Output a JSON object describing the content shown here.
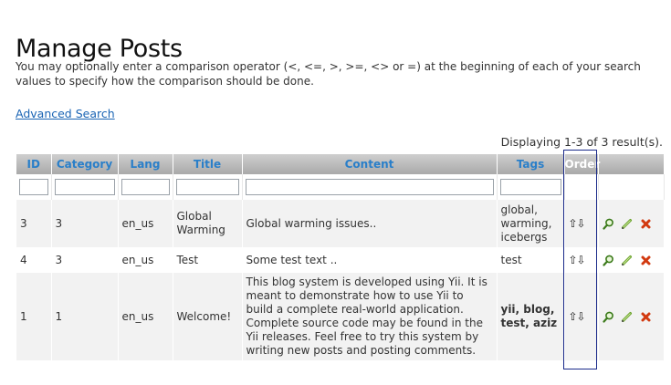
{
  "page": {
    "title": "Manage Posts",
    "intro": "You may optionally enter a comparison operator (<, <=, >, >=, <> or =) at the beginning of each of your search values to specify how the comparison should be done.",
    "advanced_search": "Advanced Search",
    "summary": "Displaying 1-3 of 3 result(s)."
  },
  "grid": {
    "columns": [
      "ID",
      "Category",
      "Lang",
      "Title",
      "Content",
      "Tags",
      "Order"
    ],
    "filters": [
      "",
      "",
      "",
      "",
      "",
      ""
    ],
    "rows": [
      {
        "id": "3",
        "category": "3",
        "lang": "en_us",
        "title": "Global Warming",
        "content": "Global warming issues..",
        "tags": "global, warming, icebergs",
        "order": "⇧⇩"
      },
      {
        "id": "4",
        "category": "3",
        "lang": "en_us",
        "title": "Test",
        "content": "Some test text ..",
        "tags": "test",
        "order": "⇧⇩"
      },
      {
        "id": "1",
        "category": "1",
        "lang": "en_us",
        "title": "Welcome!",
        "content": "This blog system is developed using Yii. It is meant to demonstrate how to use Yii to build a complete real-world application. Complete source code may be found in the Yii releases. Feel free to try this system by writing new posts and posting comments.",
        "tags": "yii, blog, test, aziz",
        "order": "⇧⇩"
      }
    ]
  },
  "icons": {
    "view": "magnifier-icon",
    "update": "pencil-icon",
    "delete": "delete-x-icon"
  },
  "colors": {
    "header_text": "#2a7fc9",
    "link": "#1a64b4",
    "highlight_border": "#1a2a8a",
    "delete": "#d23a10"
  }
}
